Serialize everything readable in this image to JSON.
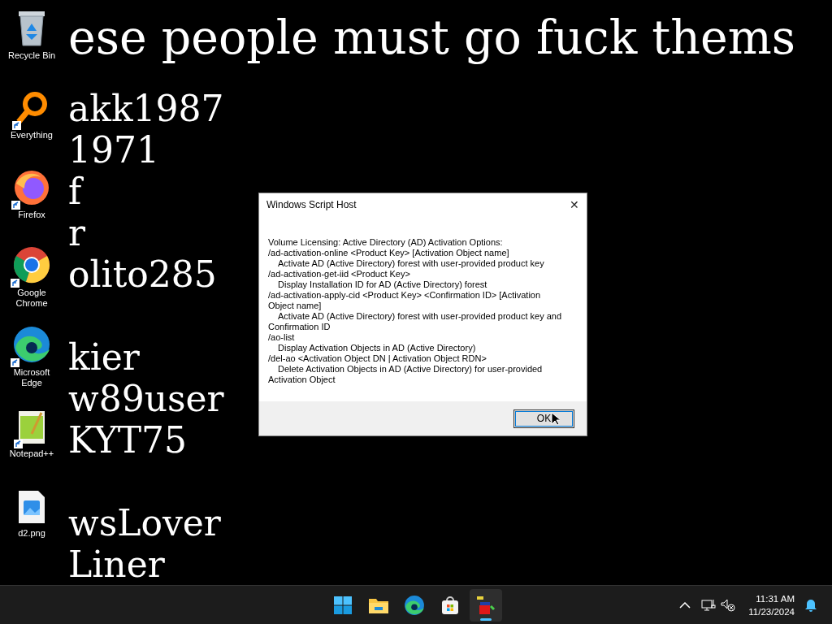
{
  "wallpaper_text": [
    "ese people must go fuck thems",
    "akk1987",
    "1971",
    "f",
    "r",
    "olito285",
    "kier",
    "w89user",
    "KYT75",
    "wsLover",
    "Liner"
  ],
  "desktop_icons": [
    {
      "label": "Recycle Bin",
      "kind": "recycle",
      "shortcut": false
    },
    {
      "label": "Everything",
      "kind": "everything",
      "shortcut": true
    },
    {
      "label": "Firefox",
      "kind": "firefox",
      "shortcut": true
    },
    {
      "label": "Google Chrome",
      "kind": "chrome",
      "shortcut": true
    },
    {
      "label": "Microsoft Edge",
      "kind": "edge",
      "shortcut": true
    },
    {
      "label": "Notepad++",
      "kind": "notepad",
      "shortcut": true
    },
    {
      "label": "d2.png",
      "kind": "image",
      "shortcut": false
    }
  ],
  "dialog": {
    "title": "Windows Script Host",
    "close": "✕",
    "message": [
      {
        "kind": "option",
        "text": "Volume Licensing: Active Directory (AD) Activation Options:"
      },
      {
        "kind": "option",
        "text": "/ad-activation-online <Product Key> [Activation Object name]"
      },
      {
        "kind": "description",
        "text": "Activate AD (Active Directory) forest with user-provided product key"
      },
      {
        "kind": "option",
        "text": "/ad-activation-get-iid <Product Key>"
      },
      {
        "kind": "description",
        "text": "Display Installation ID for AD (Active Directory) forest"
      },
      {
        "kind": "option",
        "text": "/ad-activation-apply-cid <Product Key> <Confirmation ID> [Activation Object name]"
      },
      {
        "kind": "description",
        "text": "Activate AD (Active Directory) forest with user-provided product key and Confirmation ID"
      },
      {
        "kind": "option",
        "text": "/ao-list"
      },
      {
        "kind": "description",
        "text": "Display Activation Objects in AD (Active Directory)"
      },
      {
        "kind": "option",
        "text": "/del-ao <Activation Object DN | Activation Object RDN>"
      },
      {
        "kind": "description",
        "text": "Delete Activation Objects in AD (Active Directory) for user-provided Activation Object"
      }
    ],
    "button": "OK"
  },
  "taskbar": {
    "apps": [
      {
        "kind": "start",
        "selected": false
      },
      {
        "kind": "explorer",
        "selected": false
      },
      {
        "kind": "edge",
        "selected": false
      },
      {
        "kind": "store",
        "selected": false
      },
      {
        "kind": "script",
        "selected": true
      }
    ],
    "time": "11:31 AM",
    "date": "11/23/2024"
  }
}
